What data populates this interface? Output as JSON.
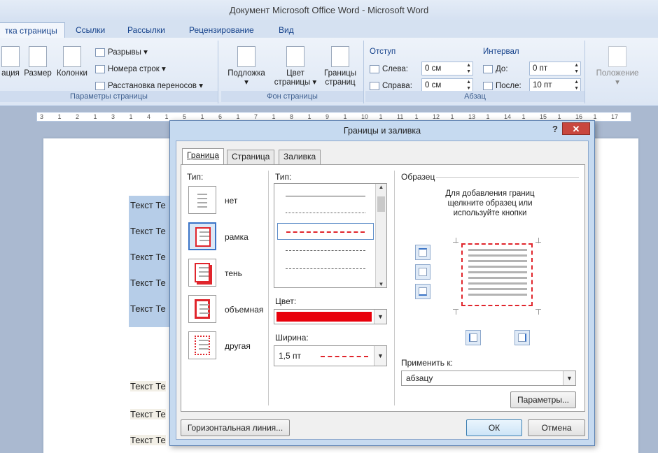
{
  "window": {
    "title": "Документ Microsoft Office Word - Microsoft Word"
  },
  "ribbon_tabs": [
    {
      "label": "тка страницы",
      "active": true
    },
    {
      "label": "Ссылки"
    },
    {
      "label": "Рассылки"
    },
    {
      "label": "Рецензирование"
    },
    {
      "label": "Вид"
    }
  ],
  "ribbon": {
    "page_setup": {
      "label": "Параметры страницы",
      "orientation": "ация",
      "size": "Размер",
      "columns": "Колонки",
      "breaks": "Разрывы",
      "line_numbers": "Номера строк",
      "hyphenation": "Расстановка переносов"
    },
    "page_background": {
      "label": "Фон страницы",
      "watermark": "Подложка",
      "page_color_1": "Цвет",
      "page_color_2": "страницы",
      "page_borders_1": "Границы",
      "page_borders_2": "страниц"
    },
    "paragraph": {
      "label": "Абзац",
      "indent_header": "Отступ",
      "left_label": "Слева:",
      "left_value": "0 см",
      "right_label": "Справа:",
      "right_value": "0 см",
      "spacing_header": "Интервал",
      "before_label": "До:",
      "before_value": "0 пт",
      "after_label": "После:",
      "after_value": "10 пт"
    },
    "arrange": {
      "position": "Положение"
    }
  },
  "ruler": {
    "marks": [
      "3",
      "1",
      "2",
      "1",
      "3",
      "1",
      "4",
      "1",
      "5",
      "1",
      "6",
      "1",
      "7",
      "1",
      "8",
      "1",
      "9",
      "1",
      "10",
      "1",
      "11",
      "1",
      "12",
      "1",
      "13",
      "1",
      "14",
      "1",
      "15",
      "1",
      "16",
      "1",
      "17"
    ]
  },
  "document": {
    "lines": [
      "Текст Те",
      "Текст Те",
      "Текст Те",
      "Текст Те",
      "Текст Те",
      "Текст Те",
      "Текст Те",
      "Текст Те"
    ]
  },
  "dialog": {
    "title": "Границы и заливка",
    "help": "?",
    "close": "✕",
    "tabs": [
      "Граница",
      "Страница",
      "Заливка"
    ],
    "type_label": "Тип:",
    "presets": [
      "нет",
      "рамка",
      "тень",
      "объемная",
      "другая"
    ],
    "style_label": "Тип:",
    "color_label": "Цвет:",
    "color_value": "#e8000b",
    "width_label": "Ширина:",
    "width_value": "1,5 пт",
    "preview_label": "Образец",
    "preview_hint_1": "Для добавления границ",
    "preview_hint_2": "щелкните образец или",
    "preview_hint_3": "используйте кнопки",
    "apply_label": "Применить к:",
    "apply_value": "абзацу",
    "options_button": "Параметры...",
    "horizontal_line_button": "Горизонтальная линия...",
    "ok_button": "ОК",
    "cancel_button": "Отмена"
  },
  "colors": {
    "border_red": "#e0252c",
    "selection_blue": "#3b74c7",
    "ribbon_text": "#15428b"
  }
}
